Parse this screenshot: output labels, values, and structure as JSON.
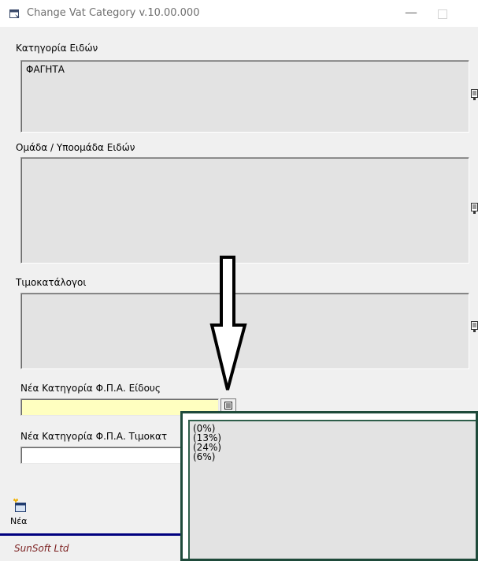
{
  "window": {
    "title": "Change Vat Category v.10.00.000",
    "minimize_glyph": "—"
  },
  "form": {
    "categories_label": "Κατηγορία Ειδών",
    "categories_items": [
      "ΦΑΓΗΤΑ"
    ],
    "groups_label": "Ομάδα / Υποομάδα Ειδών",
    "groups_items": [],
    "pricelists_label": "Τιμοκατάλογοι",
    "pricelists_items": [],
    "item_vat_label": "Νέα Κατηγορία Φ.Π.Α. Είδους",
    "item_vat_value": "",
    "pricelist_vat_label": "Νέα Κατηγορία Φ.Π.Α. Τιμοκατ",
    "pricelist_vat_value": ""
  },
  "dropdown": {
    "options": [
      "(0%)",
      "(13%)",
      "(24%)",
      "(6%)"
    ]
  },
  "footer": {
    "new_label": "Νέα",
    "company": "SunSoft Ltd"
  },
  "colors": {
    "highlight_field": "#ffffc0",
    "list_bg": "#e3e3e3",
    "popup_border": "#1e4a3a",
    "status_line": "#00007f",
    "company_text": "#7b1f1f"
  },
  "icons": [
    "window-app-icon",
    "list-button-icon",
    "down-arrow-annotation",
    "new-document-icon"
  ]
}
